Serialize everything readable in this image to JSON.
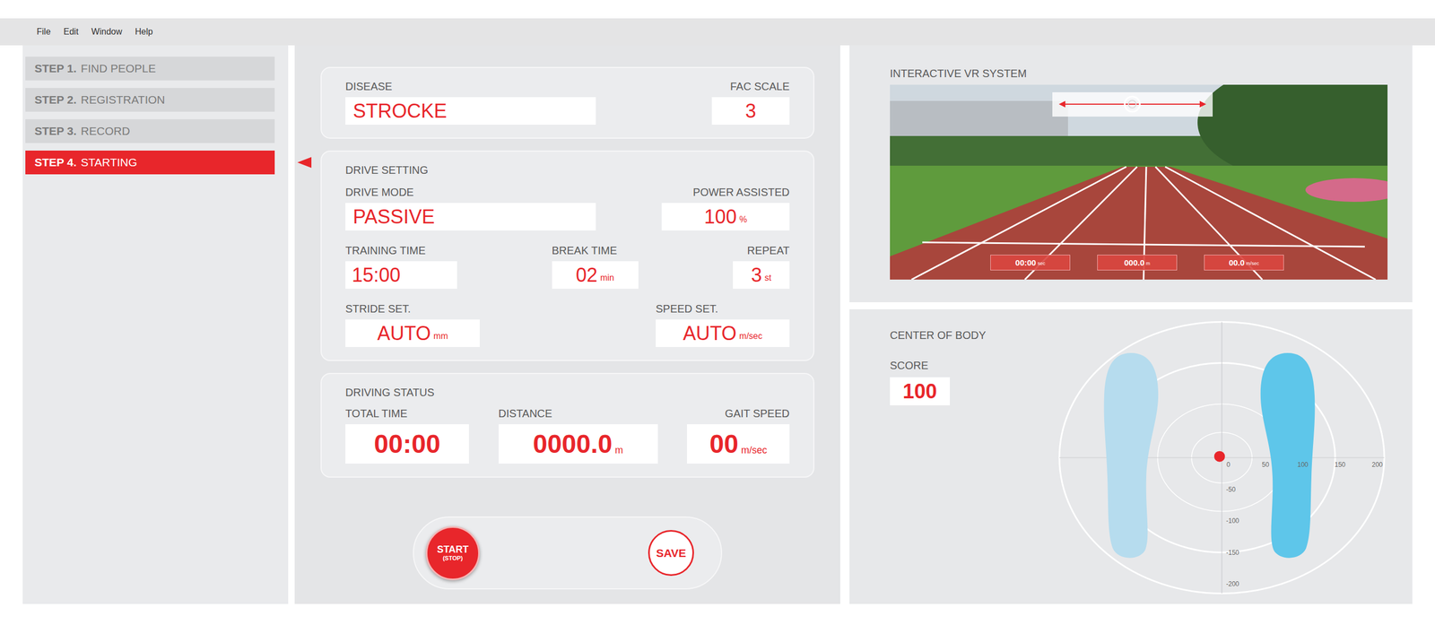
{
  "menu": [
    "File",
    "Edit",
    "Window",
    "Help"
  ],
  "steps": [
    {
      "step": "STEP 1.",
      "label": "FIND PEOPLE",
      "selected": false
    },
    {
      "step": "STEP 2.",
      "label": "REGISTRATION",
      "selected": false
    },
    {
      "step": "STEP 3.",
      "label": "RECORD",
      "selected": false
    },
    {
      "step": "STEP 4.",
      "label": "STARTING",
      "selected": true
    }
  ],
  "patient": {
    "disease": {
      "label": "DISEASE",
      "value": "STROCKE"
    },
    "fac_scale": {
      "label": "FAC SCALE",
      "value": "3"
    }
  },
  "drive_setting": {
    "title": "DRIVE SETTING",
    "drive_mode": {
      "label": "DRIVE MODE",
      "value": "PASSIVE"
    },
    "power_assisted": {
      "label": "POWER ASSISTED",
      "value": "100",
      "unit": "%"
    },
    "training_time": {
      "label": "TRAINING TIME",
      "value": "15:00"
    },
    "break_time": {
      "label": "BREAK TIME",
      "value": "02",
      "unit": "min"
    },
    "repeat": {
      "label": "REPEAT",
      "value": "3",
      "unit": "st"
    },
    "stride_set": {
      "label": "STRIDE SET.",
      "value": "AUTO",
      "unit": "mm"
    },
    "speed_set": {
      "label": "SPEED SET.",
      "value": "AUTO",
      "unit": "m/sec"
    }
  },
  "driving_status": {
    "title": "DRIVING STATUS",
    "total_time": {
      "label": "TOTAL TIME",
      "value": "00:00"
    },
    "distance": {
      "label": "DISTANCE",
      "value": "0000.0",
      "unit": "m"
    },
    "gait_speed": {
      "label": "GAIT SPEED",
      "value": "00",
      "unit": "m/sec"
    }
  },
  "buttons": {
    "start": {
      "label": "START",
      "sub": "(STOP)"
    },
    "save": {
      "label": "SAVE"
    }
  },
  "vr": {
    "title": "INTERACTIVE VR SYSTEM",
    "readings": [
      {
        "value": "00:00",
        "unit": "sec"
      },
      {
        "value": "000.0",
        "unit": "m"
      },
      {
        "value": "00.0",
        "unit": "m/sec"
      }
    ]
  },
  "center_of_body": {
    "title": "CENTER OF BODY",
    "score_label": "SCORE",
    "score": "100",
    "x_ticks": [
      "0",
      "50",
      "100",
      "150",
      "200"
    ],
    "y_ticks": [
      "-50",
      "-100",
      "-150",
      "-200"
    ],
    "point": {
      "x": -3,
      "y": 2
    },
    "feet": [
      {
        "side": "left",
        "color": "#b6dcee"
      },
      {
        "side": "right",
        "color": "#5ec6ea"
      }
    ]
  }
}
